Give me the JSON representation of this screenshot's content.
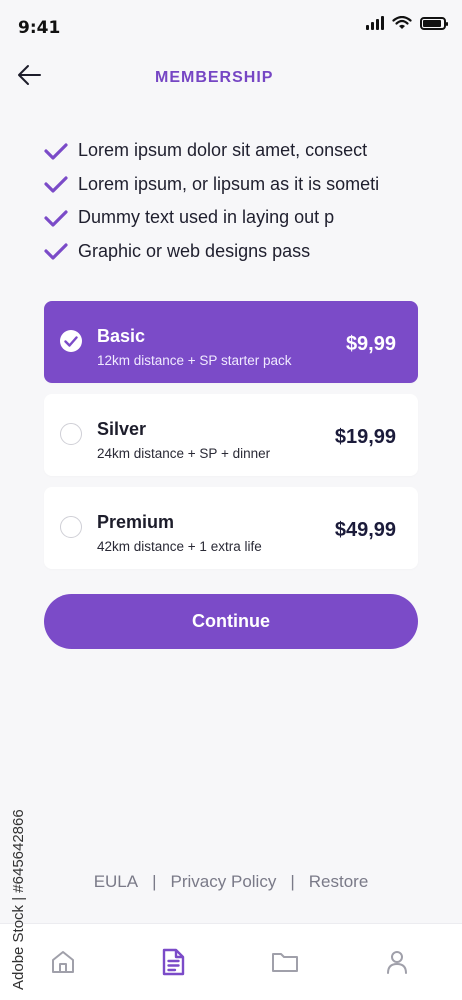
{
  "status_bar": {
    "time": "9:41"
  },
  "header": {
    "title": "MEMBERSHIP"
  },
  "features": [
    "Lorem ipsum dolor sit amet, consect",
    "Lorem ipsum, or lipsum as it is someti",
    "Dummy text used in laying out p",
    "Graphic or web designs pass"
  ],
  "plans": [
    {
      "name": "Basic",
      "description": "12km distance + SP starter pack",
      "price": "$9,99",
      "selected": true
    },
    {
      "name": "Silver",
      "description": "24km distance + SP + dinner",
      "price": "$19,99",
      "selected": false
    },
    {
      "name": "Premium",
      "description": "42km distance + 1 extra life",
      "price": "$49,99",
      "selected": false
    }
  ],
  "continue_label": "Continue",
  "footer": {
    "eula": "EULA",
    "separator": "|",
    "privacy": "Privacy Policy",
    "restore": "Restore"
  },
  "tabs": [
    {
      "icon": "home-icon",
      "active": false
    },
    {
      "icon": "document-icon",
      "active": true
    },
    {
      "icon": "folder-icon",
      "active": false
    },
    {
      "icon": "profile-icon",
      "active": false
    }
  ],
  "watermark": "Adobe Stock | #645642866",
  "colors": {
    "accent": "#7b4bc8",
    "title": "#7646c4",
    "inactive_icon": "#a0a0aa"
  }
}
